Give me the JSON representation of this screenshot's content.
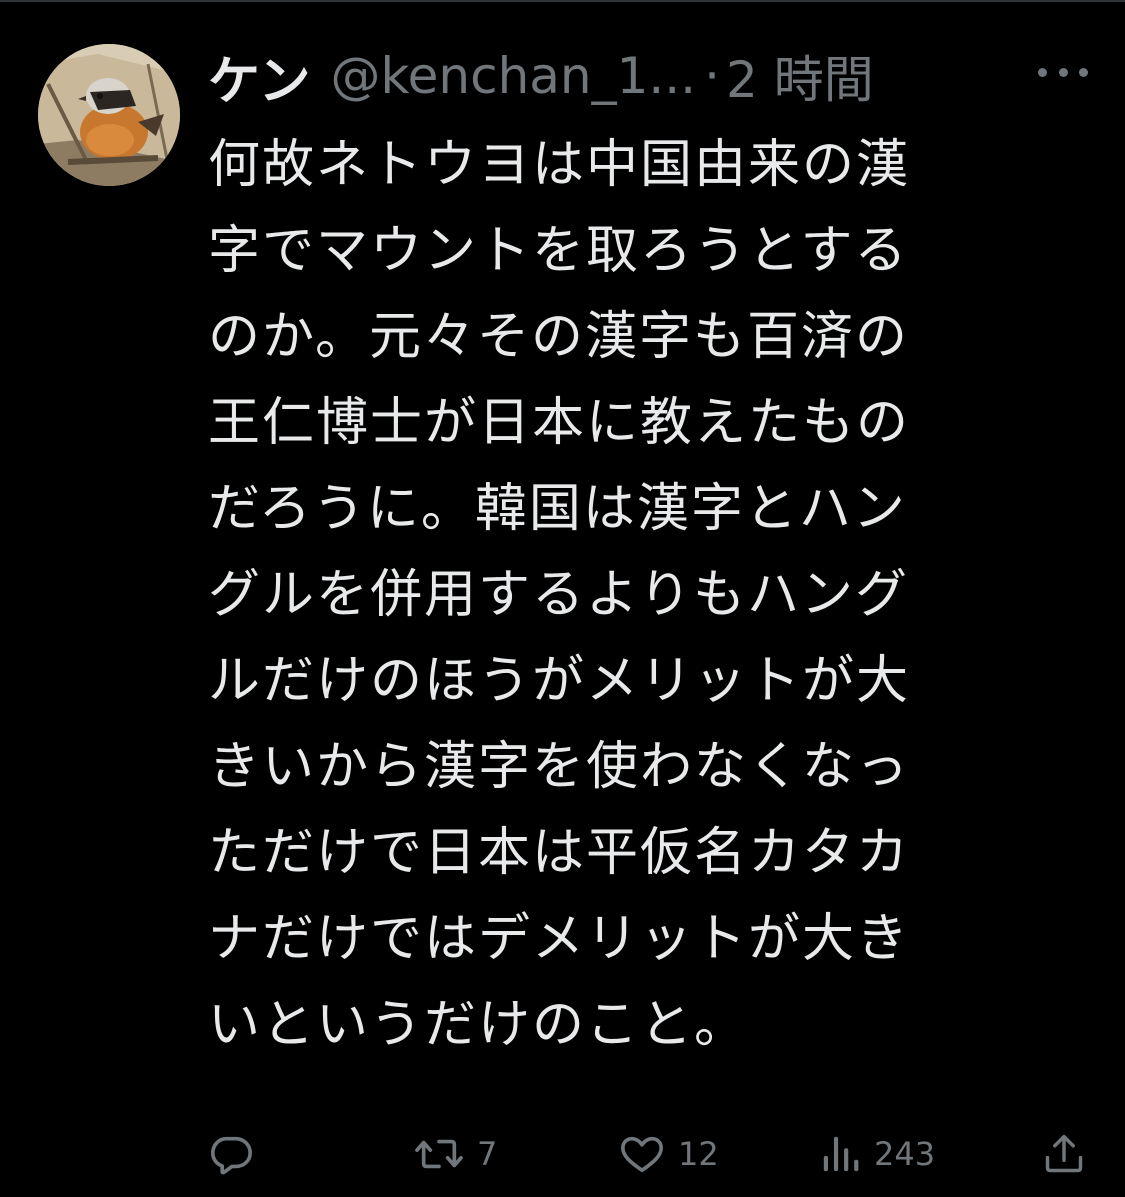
{
  "tweet": {
    "display_name": "ケン",
    "handle": "@kenchan_1...",
    "separator": "·",
    "time": "2 時間",
    "text_lines": [
      "何故ネトウヨは中国由来の漢",
      "字でマウントを取ろうとする",
      "のか。元々その漢字も百済の",
      "王仁博士が日本に教えたもの",
      "だろうに。韓国は漢字とハン",
      "グルを併用するよりもハング",
      "ルだけのほうがメリットが大",
      "きいから漢字を使わなくなっ",
      "ただけで日本は平仮名カタカ",
      "ナだけではデメリットが大き",
      "いというだけのこと。"
    ]
  },
  "actions": {
    "reply": {
      "icon": "reply-icon",
      "count": ""
    },
    "retweet": {
      "icon": "retweet-icon",
      "count": "7"
    },
    "like": {
      "icon": "heart-icon",
      "count": "12"
    },
    "views": {
      "icon": "views-icon",
      "count": "243"
    },
    "share": {
      "icon": "share-icon",
      "count": ""
    }
  },
  "colors": {
    "background": "#000000",
    "text": "#e7e9ea",
    "secondary": "#71767b",
    "divider": "#2f3336"
  }
}
